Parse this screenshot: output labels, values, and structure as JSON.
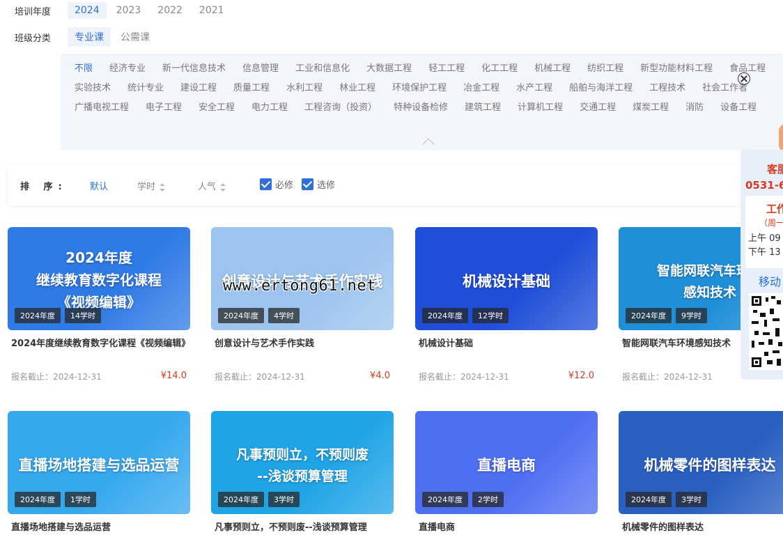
{
  "filters": {
    "year_label": "培训年度",
    "years": [
      "2024",
      "2023",
      "2022",
      "2021"
    ],
    "class_label": "班级分类",
    "classes": [
      "专业课",
      "公需课"
    ],
    "categories": [
      "不限",
      "经济专业",
      "新一代信息技术",
      "信息管理",
      "工业和信息化",
      "大数据工程",
      "轻工工程",
      "化工工程",
      "机械工程",
      "纺织工程",
      "新型功能材料工程",
      "食品工程",
      "实验技术",
      "统计专业",
      "建设工程",
      "质量工程",
      "水利工程",
      "林业工程",
      "环境保护工程",
      "冶金工程",
      "水产工程",
      "船舶与海洋工程",
      "工程技术",
      "社会工作者",
      "广播电视工程",
      "电子工程",
      "安全工程",
      "电力工程",
      "工程咨询（投资）",
      "特种设备检修",
      "建筑工程",
      "计算机工程",
      "交通工程",
      "煤炭工程",
      "消防",
      "设备工程"
    ]
  },
  "sort": {
    "label": "排 序:",
    "default": "默认",
    "hours": "学时",
    "popularity": "人气",
    "required": "必修",
    "elective": "选修"
  },
  "courses": [
    {
      "thumb": "2024年度\n继续教育数字化课程\n《视频编辑》",
      "year": "2024年度",
      "hours": "14学时",
      "name": "2024年度继续教育数字化课程《视频编辑》",
      "deadline": "报名截止：2024-12-31",
      "price": "¥14.0",
      "bg": "#2f7ae5"
    },
    {
      "thumb": "创意设计与艺术手作实践",
      "year": "2024年度",
      "hours": "4学时",
      "name": "创意设计与艺术手作实践",
      "deadline": "报名截止：2024-12-31",
      "price": "¥4.0",
      "bg": "#9cc4ef"
    },
    {
      "thumb": "机械设计基础",
      "year": "2024年度",
      "hours": "12学时",
      "name": "机械设计基础",
      "deadline": "报名截止：2024-12-31",
      "price": "¥12.0",
      "bg": "#1f4ed8"
    },
    {
      "thumb": "智能网联汽车环境\n感知技术",
      "year": "2024年度",
      "hours": "9学时",
      "name": "智能网联汽车环境感知技术",
      "deadline": "报名截止：2024-12-31",
      "price": "¥",
      "bg": "#1f8fd9"
    },
    {
      "thumb": "直播场地搭建与选品运营",
      "year": "2024年度",
      "hours": "1学时",
      "name": "直播场地搭建与选品运营",
      "deadline": "",
      "price": "",
      "bg": "#36a8ee"
    },
    {
      "thumb": "凡事预则立，不预则废\n--浅谈预算管理",
      "year": "2024年度",
      "hours": "3学时",
      "name": "凡事预则立，不预则废--浅谈预算管理",
      "deadline": "",
      "price": "",
      "bg": "#1fa4e6"
    },
    {
      "thumb": "直播电商",
      "year": "2024年度",
      "hours": "2学时",
      "name": "直播电商",
      "deadline": "",
      "price": "",
      "bg": "#4f6ff2"
    },
    {
      "thumb": "机械零件的图样表达",
      "year": "2024年度",
      "hours": "3学时",
      "name": "机械零件的图样表达",
      "deadline": "",
      "price": "",
      "bg": "#2b60c2"
    }
  ],
  "side_widget": {
    "title": "客服",
    "phone": "0531-6",
    "work": "工作",
    "week": "（周一",
    "am": "上午 09",
    "pm": "下午 13",
    "mobile": "移动"
  },
  "watermark": "www.ertong61.net"
}
